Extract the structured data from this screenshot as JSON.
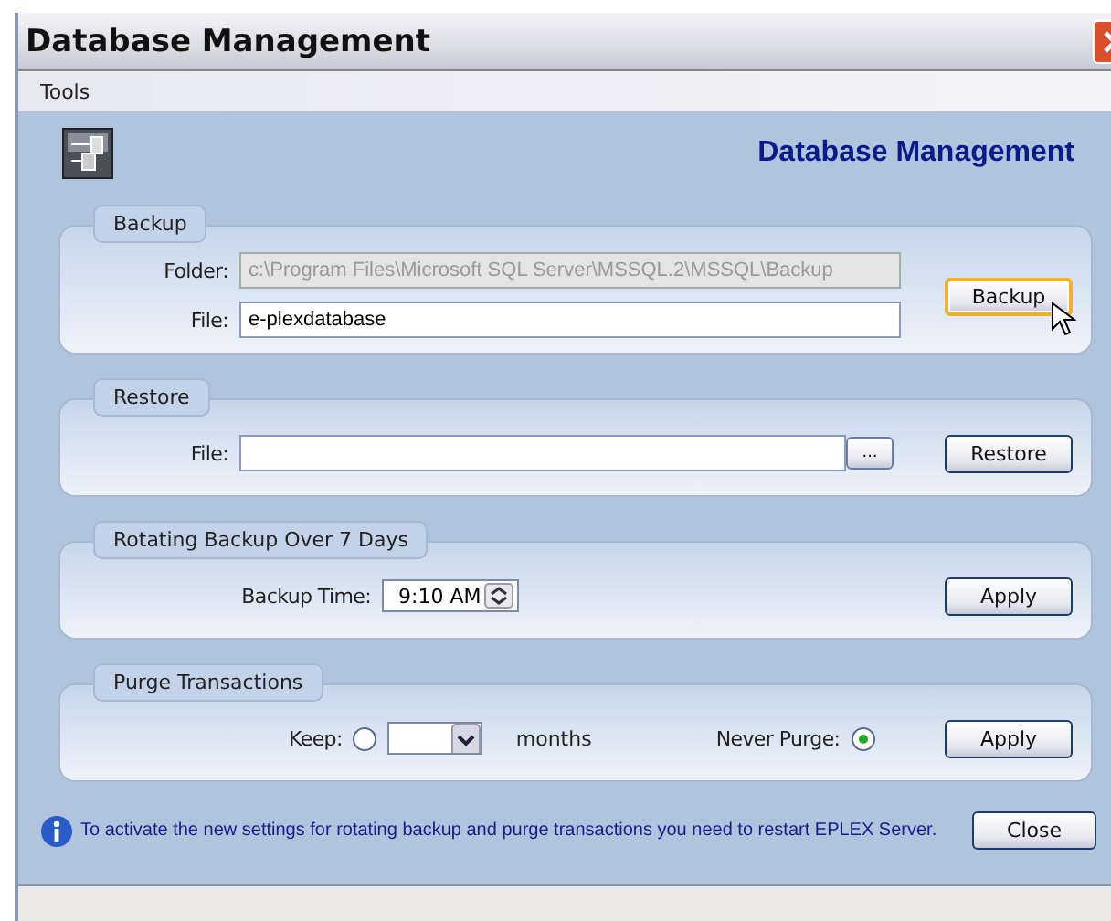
{
  "window": {
    "title": "Database Management"
  },
  "menu": [
    "Tools"
  ],
  "header": {
    "title": "Database Management"
  },
  "backup": {
    "legend": "Backup",
    "folder": {
      "label": "Folder:",
      "value": "c:\\Program Files\\Microsoft SQL Server\\MSSQL.2\\MSSQL\\Backup",
      "disabled": true
    },
    "file": {
      "label": "File:",
      "value": "e-plexdatabase",
      "disabled": false
    },
    "button": {
      "label": "Backup",
      "focused": true
    }
  },
  "restore": {
    "legend": "Restore",
    "file": {
      "label": "File:"
    },
    "browse": "...",
    "button": {
      "label": "Restore",
      "focused": false
    }
  },
  "rotating": {
    "legend": "Rotating Backup Over 7 Days",
    "time_label": "Backup Time:",
    "time": "9:10 AM",
    "button": {
      "label": "Apply",
      "focused": false
    }
  },
  "purge": {
    "legend": "Purge Transactions",
    "options": [
      {
        "label": "Keep:",
        "selected": false,
        "unit": "months"
      },
      {
        "label": "Never Purge:",
        "selected": true
      }
    ],
    "button": {
      "label": "Apply",
      "focused": false
    }
  },
  "footer": {
    "message": "To activate the new settings for rotating backup and purge transactions you need to restart EPLEX Server.",
    "button": {
      "label": "Close",
      "focused": false
    }
  }
}
